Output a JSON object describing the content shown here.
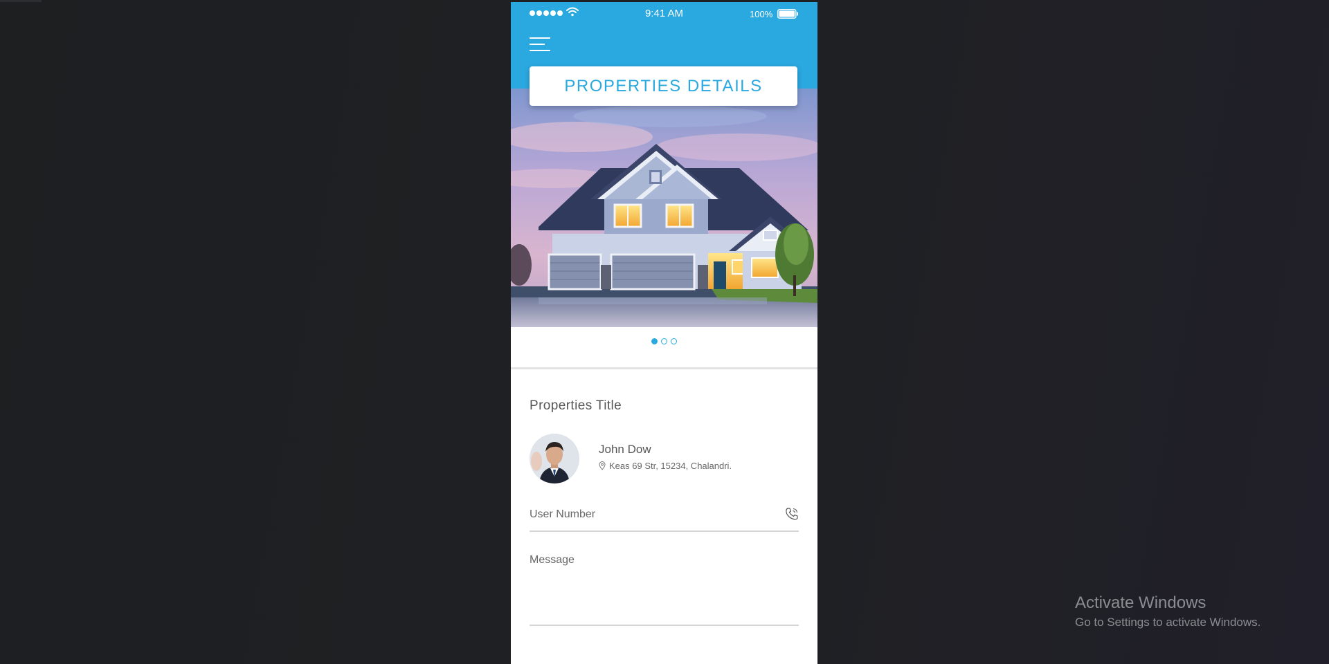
{
  "status_bar": {
    "time": "9:41 AM",
    "battery_percent": "100%",
    "signal_icon": "signal-dots-icon",
    "wifi_icon": "wifi-icon",
    "battery_icon": "battery-icon"
  },
  "header": {
    "menu_icon": "hamburger-menu-icon",
    "title": "PROPERTIES DETAILS",
    "background_color": "#2aa8e0"
  },
  "carousel": {
    "total_slides": 3,
    "active_index": 0
  },
  "property": {
    "title": "Properties Title",
    "agent": {
      "name": "John Dow",
      "address": "Keas 69 Str, 15234, Chalandri."
    }
  },
  "form": {
    "user_number_label": "User Number",
    "message_label": "Message"
  },
  "watermark": {
    "title": "Activate Windows",
    "subtitle": "Go to Settings to activate Windows."
  }
}
